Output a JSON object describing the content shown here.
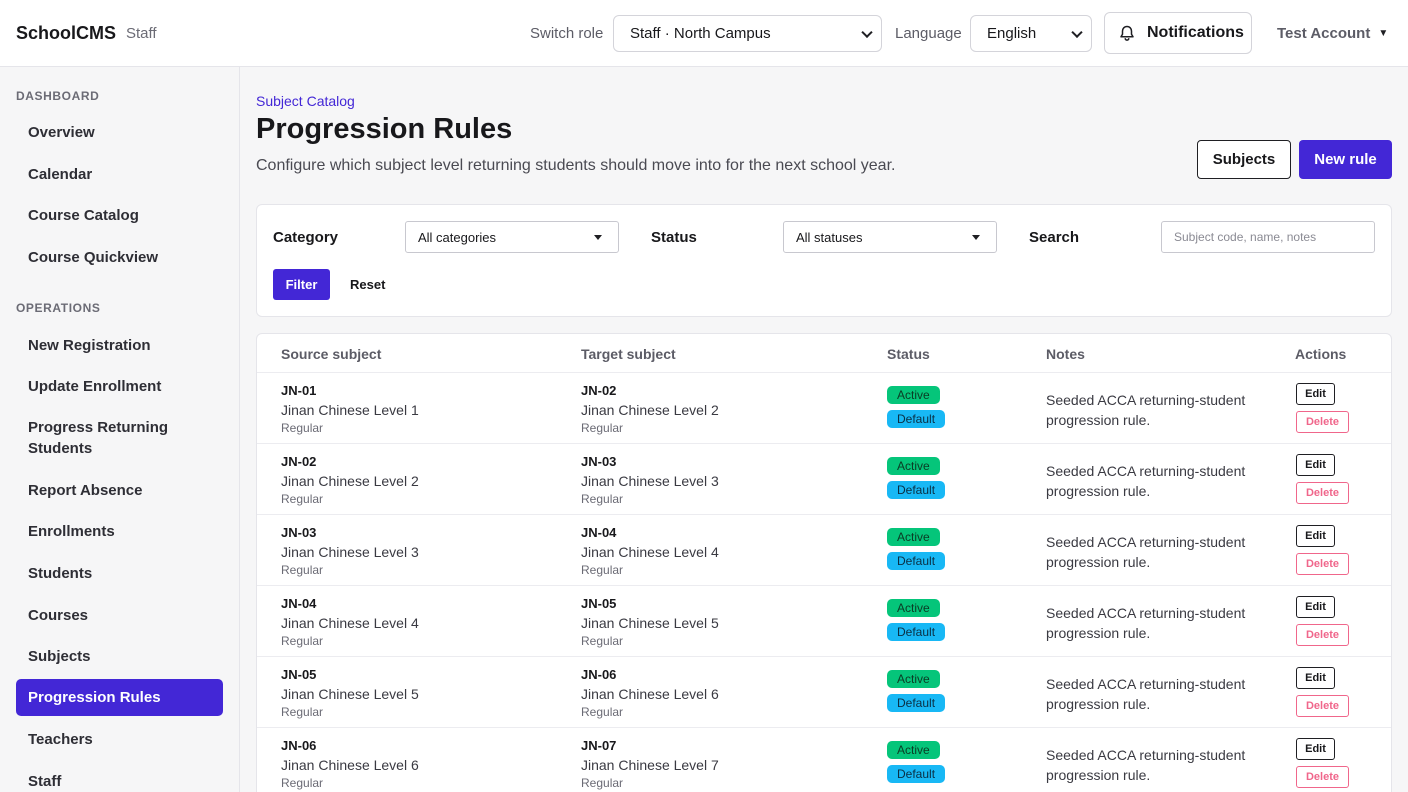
{
  "header": {
    "brand": "SchoolCMS",
    "brand_sub": "Staff",
    "switch_role_label": "Switch role",
    "role_value": "Staff · North Campus",
    "language_label": "Language",
    "language_value": "English",
    "notifications_label": "Notifications",
    "account_label": "Test Account"
  },
  "sidebar": {
    "sections": [
      {
        "title": "DASHBOARD"
      },
      {
        "title": "OPERATIONS"
      }
    ],
    "items": [
      {
        "label": "Overview"
      },
      {
        "label": "Calendar"
      },
      {
        "label": "Course Catalog"
      },
      {
        "label": "Course Quickview"
      },
      {
        "label": "New Registration"
      },
      {
        "label": "Update Enrollment"
      },
      {
        "label": "Progress Returning Students"
      },
      {
        "label": "Report Absence"
      },
      {
        "label": "Enrollments"
      },
      {
        "label": "Students"
      },
      {
        "label": "Courses"
      },
      {
        "label": "Subjects"
      },
      {
        "label": "Progression Rules"
      },
      {
        "label": "Teachers"
      },
      {
        "label": "Staff"
      }
    ],
    "active_item": "Progression Rules"
  },
  "page": {
    "breadcrumb": "Subject Catalog",
    "title": "Progression Rules",
    "subtitle": "Configure which subject level returning students should move into for the next school year.",
    "subjects_button": "Subjects",
    "new_rule_button": "New rule"
  },
  "filters": {
    "category_label": "Category",
    "category_value": "All categories",
    "status_label": "Status",
    "status_value": "All statuses",
    "search_label": "Search",
    "search_placeholder": "Subject code, name, notes",
    "filter_button": "Filter",
    "reset_button": "Reset"
  },
  "table": {
    "headers": {
      "source": "Source subject",
      "target": "Target subject",
      "status": "Status",
      "notes": "Notes",
      "actions": "Actions"
    },
    "edit_label": "Edit",
    "delete_label": "Delete",
    "rows": [
      {
        "src_code": "JN-01",
        "src_name": "Jinan Chinese Level 1",
        "src_type": "Regular",
        "tgt_code": "JN-02",
        "tgt_name": "Jinan Chinese Level 2",
        "tgt_type": "Regular",
        "status": "Active",
        "flag": "Default",
        "notes": "Seeded ACCA returning-student progression rule."
      },
      {
        "src_code": "JN-02",
        "src_name": "Jinan Chinese Level 2",
        "src_type": "Regular",
        "tgt_code": "JN-03",
        "tgt_name": "Jinan Chinese Level 3",
        "tgt_type": "Regular",
        "status": "Active",
        "flag": "Default",
        "notes": "Seeded ACCA returning-student progression rule."
      },
      {
        "src_code": "JN-03",
        "src_name": "Jinan Chinese Level 3",
        "src_type": "Regular",
        "tgt_code": "JN-04",
        "tgt_name": "Jinan Chinese Level 4",
        "tgt_type": "Regular",
        "status": "Active",
        "flag": "Default",
        "notes": "Seeded ACCA returning-student progression rule."
      },
      {
        "src_code": "JN-04",
        "src_name": "Jinan Chinese Level 4",
        "src_type": "Regular",
        "tgt_code": "JN-05",
        "tgt_name": "Jinan Chinese Level 5",
        "tgt_type": "Regular",
        "status": "Active",
        "flag": "Default",
        "notes": "Seeded ACCA returning-student progression rule."
      },
      {
        "src_code": "JN-05",
        "src_name": "Jinan Chinese Level 5",
        "src_type": "Regular",
        "tgt_code": "JN-06",
        "tgt_name": "Jinan Chinese Level 6",
        "tgt_type": "Regular",
        "status": "Active",
        "flag": "Default",
        "notes": "Seeded ACCA returning-student progression rule."
      },
      {
        "src_code": "JN-06",
        "src_name": "Jinan Chinese Level 6",
        "src_type": "Regular",
        "tgt_code": "JN-07",
        "tgt_name": "Jinan Chinese Level 7",
        "tgt_type": "Regular",
        "status": "Active",
        "flag": "Default",
        "notes": "Seeded ACCA returning-student progression rule."
      }
    ]
  },
  "colors": {
    "accent": "#4327d6",
    "active_badge": "#05c57a",
    "default_badge": "#18b8f5",
    "delete": "#f0668b"
  }
}
